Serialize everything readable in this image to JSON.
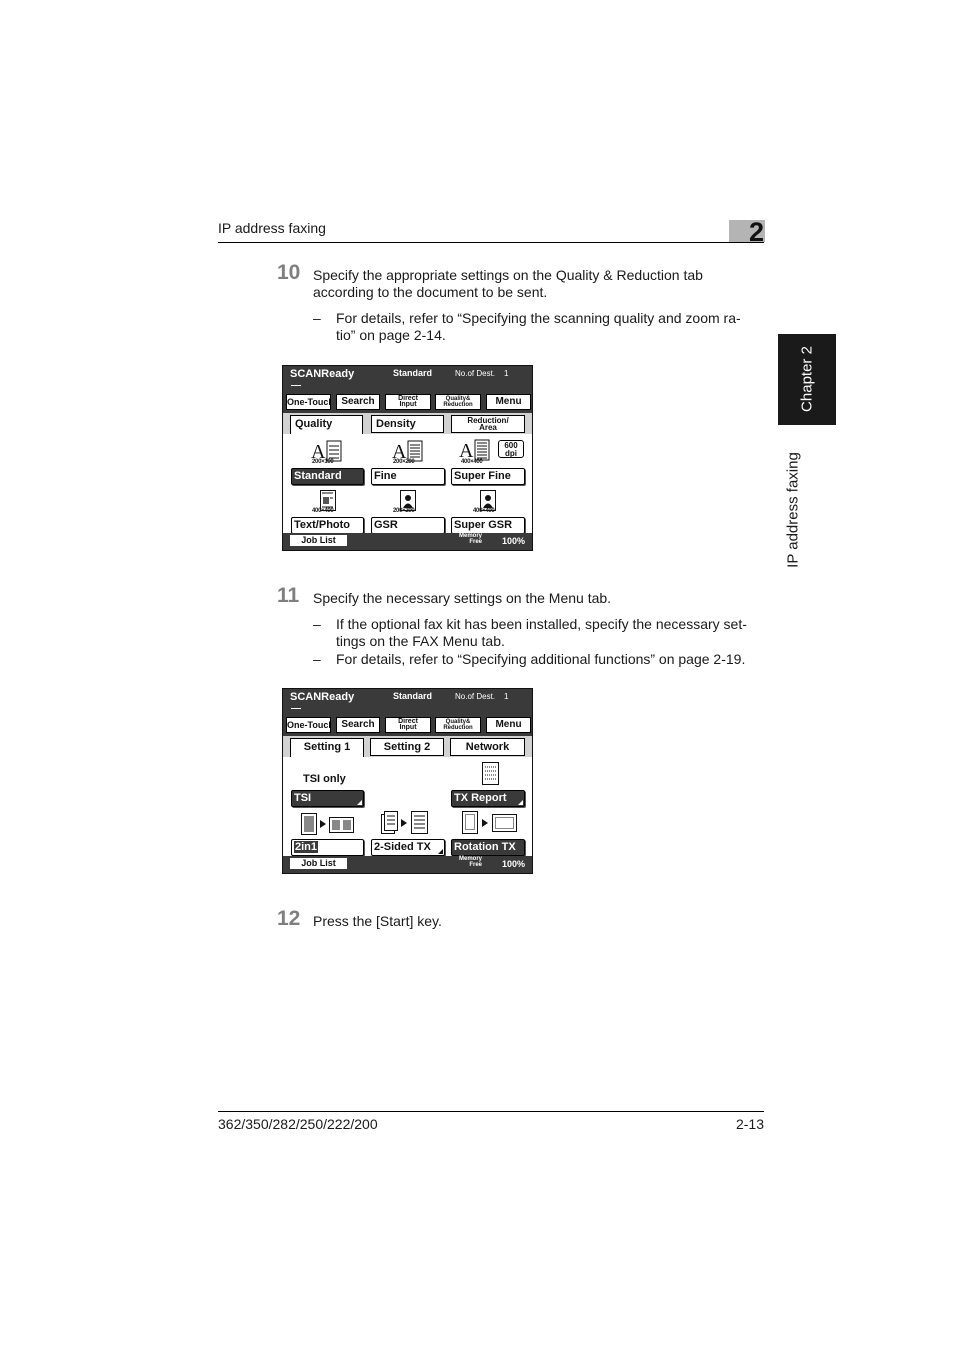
{
  "header": {
    "section_title": "IP address faxing",
    "chapter_number": "2"
  },
  "side_tab": {
    "chapter_label": "Chapter 2",
    "section_label": "IP address faxing"
  },
  "steps": [
    {
      "number": "10",
      "text_line1": "Specify the appropriate settings on the Quality & Reduction tab",
      "text_line2": "according to the document to be sent.",
      "bullets": [
        {
          "dash": "–",
          "line1": "For details, refer to “Specifying the scanning quality and zoom ra-",
          "line2": "tio” on page 2-14."
        }
      ]
    },
    {
      "number": "11",
      "text_line1": "Specify the necessary settings on the Menu tab.",
      "bullets": [
        {
          "dash": "–",
          "line1": "If the optional fax kit has been installed, specify the necessary set-",
          "line2": "tings on the FAX Menu tab."
        },
        {
          "dash": "–",
          "line1": "For details, refer to “Specifying additional functions” on page 2-19."
        }
      ]
    },
    {
      "number": "12",
      "text_line1": "Press the [Start] key."
    }
  ],
  "panel_common": {
    "title": "SCANReady",
    "mode": "Standard",
    "dest_label": "No.of Dest.",
    "dest_count": "1",
    "tabs": {
      "one_touch": "One-Touch",
      "search": "Search",
      "direct_input_1": "Direct",
      "direct_input_2": "Input",
      "quality_reduction_1": "Quality&",
      "quality_reduction_2": "Reduction",
      "menu": "Menu"
    },
    "job_list": "Job List",
    "memory_1": "Memory",
    "memory_2": "Free",
    "memory_pct": "100%"
  },
  "panel_quality": {
    "subtabs": {
      "quality": "Quality",
      "density": "Density",
      "reduction_1": "Reduction/",
      "reduction_2": "Area"
    },
    "res": {
      "r1": "200×100",
      "r2": "200×200",
      "r3": "400×400",
      "r4": "400×400",
      "r5": "200×200",
      "r6": "400×400"
    },
    "dpi_1": "600",
    "dpi_2": "dpi",
    "buttons": {
      "standard": "Standard",
      "fine": "Fine",
      "super_fine": "Super Fine",
      "text_photo": "Text/Photo",
      "gsr": "GSR",
      "super_gsr": "Super GSR"
    }
  },
  "panel_menu": {
    "subtabs": {
      "setting1": "Setting 1",
      "setting2": "Setting 2",
      "network": "Network"
    },
    "tsi_only": "TSI only",
    "buttons": {
      "tsi": "TSI",
      "tx_report": "TX Report",
      "two_in_one": "2in1",
      "two_sided_tx": "2-Sided TX",
      "rotation_tx": "Rotation TX"
    }
  },
  "footer": {
    "models": "362/350/282/250/222/200",
    "page": "2-13"
  }
}
